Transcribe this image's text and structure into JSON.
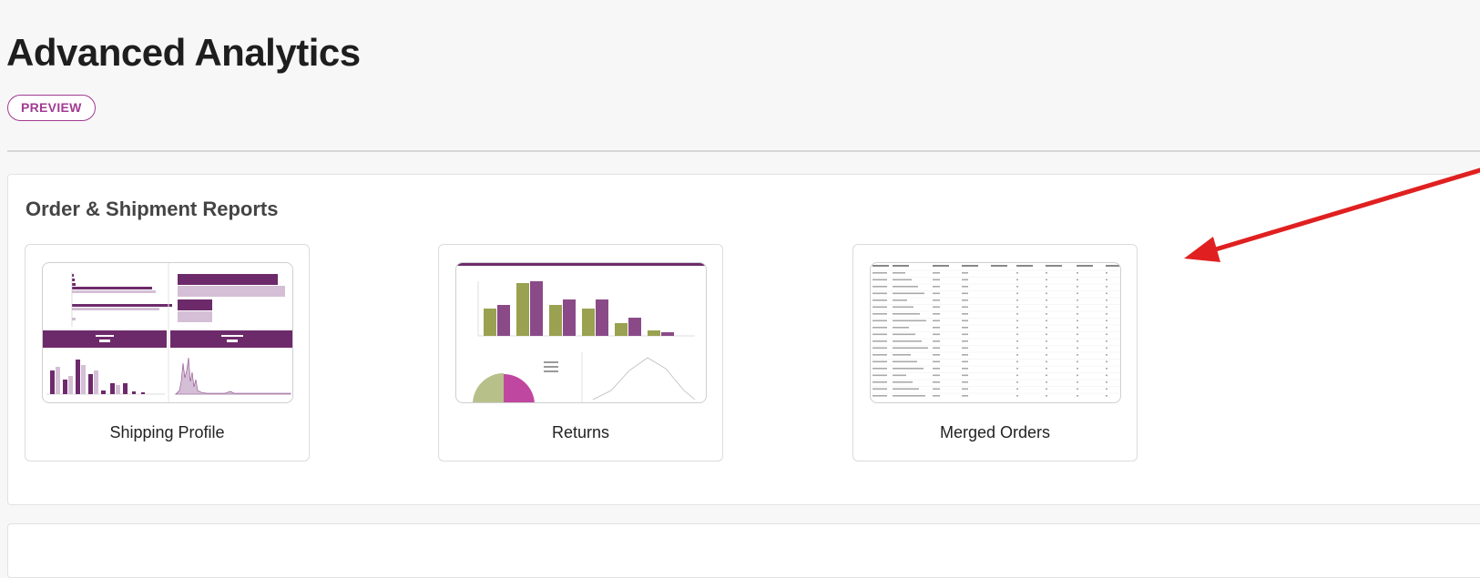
{
  "page": {
    "title": "Advanced Analytics",
    "badge": "PREVIEW"
  },
  "section": {
    "title": "Order & Shipment Reports"
  },
  "cards": [
    {
      "label": "Shipping Profile",
      "thumbnail": "dashboard-preview"
    },
    {
      "label": "Returns",
      "thumbnail": "bar-chart-preview"
    },
    {
      "label": "Merged Orders",
      "thumbnail": "table-preview"
    }
  ],
  "colors": {
    "accent": "#a23b93",
    "chart_purple": "#6d2a6b",
    "chart_olive": "#9aa150",
    "chart_lavender": "#d4bfd6",
    "annotation_arrow": "#e02020"
  }
}
